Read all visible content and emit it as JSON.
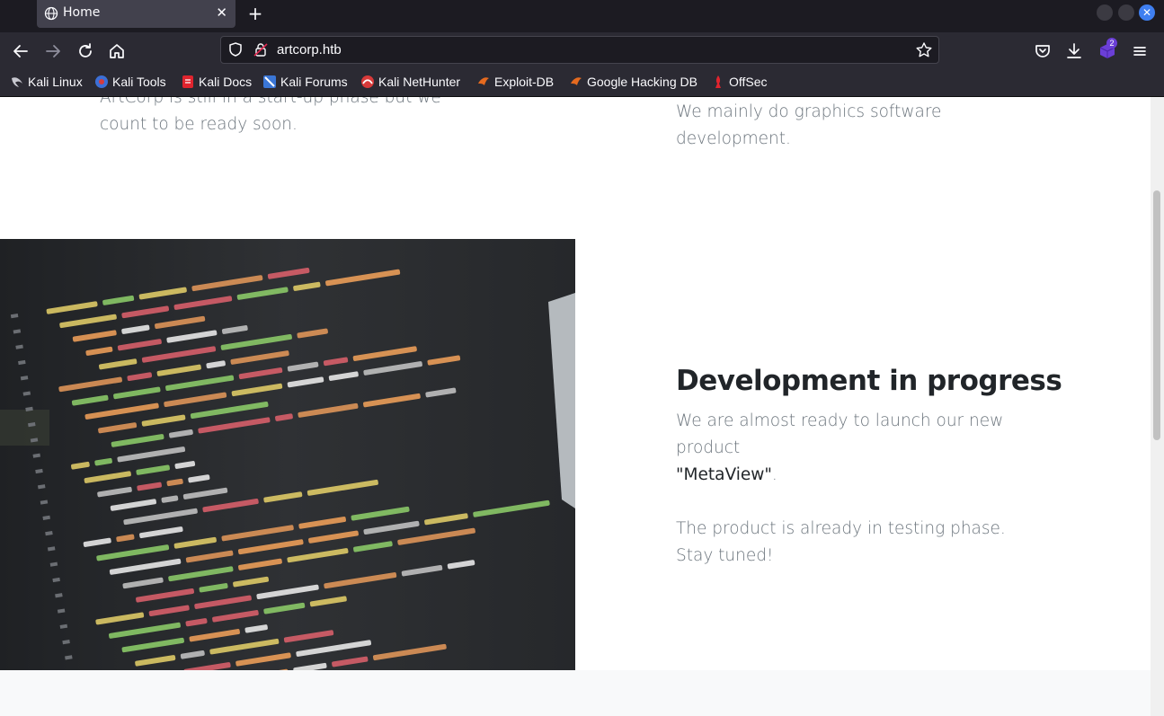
{
  "browser": {
    "tab_title": "Home",
    "url": "artcorp.htb",
    "extension_badge": "2",
    "bookmarks": [
      {
        "label": "Kali Linux",
        "icon": "kali-dragon-icon"
      },
      {
        "label": "Kali Tools",
        "icon": "kali-tools-icon"
      },
      {
        "label": "Kali Docs",
        "icon": "kali-docs-icon"
      },
      {
        "label": "Kali Forums",
        "icon": "kali-forums-icon"
      },
      {
        "label": "Kali NetHunter",
        "icon": "kali-nethunter-icon"
      },
      {
        "label": "Exploit-DB",
        "icon": "exploit-db-icon"
      },
      {
        "label": "Google Hacking DB",
        "icon": "ghdb-icon"
      },
      {
        "label": "OffSec",
        "icon": "offsec-icon"
      }
    ]
  },
  "page": {
    "intro_left": "ArtCorp is still in a start-up phase but we count to be ready soon.",
    "intro_right": "We mainly do graphics software development.",
    "feature": {
      "heading": "Development in progress",
      "line1": "We are almost ready to launch our new product",
      "product": "\"MetaView\"",
      "after_product": ".",
      "line2": "The product is already in testing phase.",
      "line3": "Stay tuned!"
    }
  },
  "colors": {
    "chrome_dark": "#1c1b22",
    "chrome": "#2b2a33",
    "tab_active": "#42414d",
    "text_muted": "#6c757d",
    "heading": "#212529",
    "band": "#f8f9fa"
  }
}
